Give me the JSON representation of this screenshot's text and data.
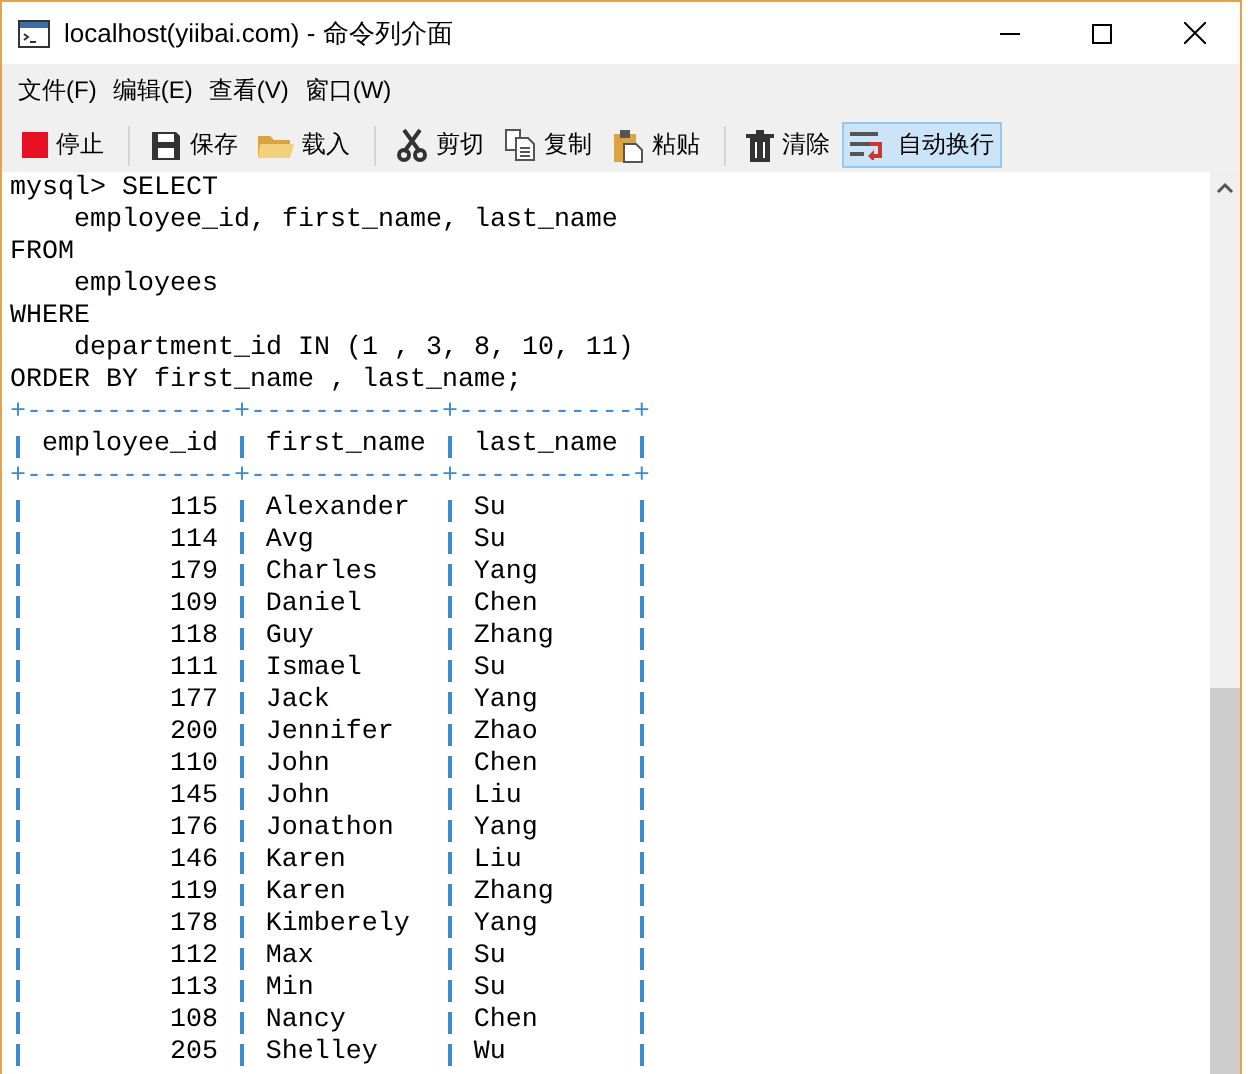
{
  "window": {
    "title": "localhost(yiibai.com) - 命令列介面"
  },
  "menu": [
    {
      "label": "文件(F)"
    },
    {
      "label": "编辑(E)"
    },
    {
      "label": "查看(V)"
    },
    {
      "label": "窗口(W)"
    }
  ],
  "toolbar": [
    {
      "items": [
        {
          "kind": "stop",
          "label": "停止",
          "selected": false
        }
      ]
    },
    {
      "items": [
        {
          "kind": "save",
          "label": "保存",
          "selected": false
        },
        {
          "kind": "load",
          "label": "载入",
          "selected": false
        }
      ]
    },
    {
      "items": [
        {
          "kind": "cut",
          "label": "剪切",
          "selected": false
        },
        {
          "kind": "copy",
          "label": "复制",
          "selected": false
        },
        {
          "kind": "paste",
          "label": "粘贴",
          "selected": false
        }
      ]
    },
    {
      "items": [
        {
          "kind": "clear",
          "label": "清除",
          "selected": false
        },
        {
          "kind": "wrap",
          "label": "自动换行",
          "selected": true
        }
      ]
    }
  ],
  "console": {
    "query_lines": [
      "mysql> SELECT",
      "    employee_id, first_name, last_name",
      "FROM",
      "    employees",
      "WHERE",
      "    department_id IN (1 , 3, 8, 10, 11)",
      "ORDER BY first_name , last_name;"
    ],
    "table": {
      "top_border": "+-------------+------------+-----------+",
      "columns": [
        "employee_id",
        "first_name",
        "last_name"
      ],
      "header_border": "+-------------+------------+-----------+",
      "rows": [
        {
          "cells": [
            "115",
            "Alexander",
            "Su"
          ]
        },
        {
          "cells": [
            "114",
            "Avg",
            "Su"
          ]
        },
        {
          "cells": [
            "179",
            "Charles",
            "Yang"
          ]
        },
        {
          "cells": [
            "109",
            "Daniel",
            "Chen"
          ]
        },
        {
          "cells": [
            "118",
            "Guy",
            "Zhang"
          ]
        },
        {
          "cells": [
            "111",
            "Ismael",
            "Su"
          ]
        },
        {
          "cells": [
            "177",
            "Jack",
            "Yang"
          ]
        },
        {
          "cells": [
            "200",
            "Jennifer",
            "Zhao"
          ]
        },
        {
          "cells": [
            "110",
            "John",
            "Chen"
          ]
        },
        {
          "cells": [
            "145",
            "John",
            "Liu"
          ]
        },
        {
          "cells": [
            "176",
            "Jonathon",
            "Yang"
          ]
        },
        {
          "cells": [
            "146",
            "Karen",
            "Liu"
          ]
        },
        {
          "cells": [
            "119",
            "Karen",
            "Zhang"
          ]
        },
        {
          "cells": [
            "178",
            "Kimberely",
            "Yang"
          ]
        },
        {
          "cells": [
            "112",
            "Max",
            "Su"
          ]
        },
        {
          "cells": [
            "113",
            "Min",
            "Su"
          ]
        },
        {
          "cells": [
            "108",
            "Nancy",
            "Chen"
          ]
        },
        {
          "cells": [
            "205",
            "Shelley",
            "Wu"
          ]
        }
      ]
    }
  }
}
